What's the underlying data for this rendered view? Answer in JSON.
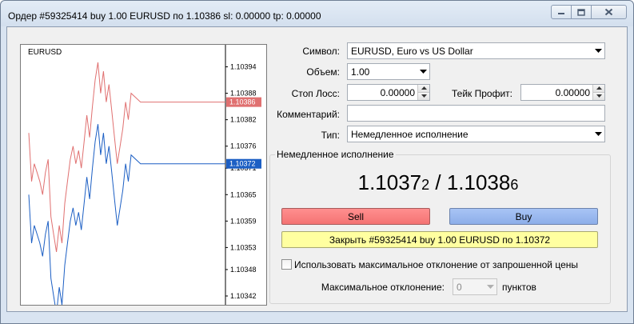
{
  "window": {
    "title": "Ордер #59325414 buy 1.00 EURUSD по 1.10386 sl: 0.00000 tp: 0.00000"
  },
  "chart": {
    "symbol": "EURUSD",
    "tick_labels": [
      "1.10394",
      "1.10388",
      "1.10382",
      "1.10376",
      "1.10371",
      "1.10365",
      "1.10359",
      "1.10353",
      "1.10348",
      "1.10342"
    ],
    "ask_tag": "1.10386",
    "bid_tag": "1.10372",
    "colors": {
      "ask": "#e07070",
      "bid": "#1c5fc4",
      "ask_tag_bg": "#e07070",
      "bid_tag_bg": "#1c5fc4"
    }
  },
  "chart_data": {
    "type": "line",
    "title": "EURUSD",
    "y_ticks": [
      1.10394,
      1.10388,
      1.10382,
      1.10376,
      1.10371,
      1.10365,
      1.10359,
      1.10353,
      1.10348,
      1.10342
    ],
    "ylim": [
      1.1034,
      1.10399
    ],
    "series": [
      {
        "name": "Ask",
        "values": [
          1.10379,
          1.10368,
          1.10372,
          1.1037,
          1.10368,
          1.10365,
          1.1037,
          1.10373,
          1.1036,
          1.10356,
          1.10352,
          1.10358,
          1.10354,
          1.10363,
          1.10368,
          1.10373,
          1.10376,
          1.10372,
          1.10375,
          1.10371,
          1.10377,
          1.10383,
          1.10378,
          1.10385,
          1.10391,
          1.10395,
          1.10388,
          1.10393,
          1.10386,
          1.1039,
          1.10384,
          1.10378,
          1.10372,
          1.10376,
          1.1038,
          1.10386,
          1.10382,
          1.10388,
          1.10386,
          1.10386,
          1.10386,
          1.10386,
          1.10386,
          1.10386,
          1.10386,
          1.10386,
          1.10386,
          1.10386
        ]
      },
      {
        "name": "Bid",
        "values": [
          1.10365,
          1.10354,
          1.10358,
          1.10356,
          1.10354,
          1.10351,
          1.10356,
          1.10359,
          1.10346,
          1.10342,
          1.10338,
          1.10344,
          1.1034,
          1.10349,
          1.10354,
          1.10359,
          1.10362,
          1.10358,
          1.10361,
          1.10357,
          1.10363,
          1.10369,
          1.10364,
          1.10371,
          1.10377,
          1.10381,
          1.10374,
          1.10379,
          1.10372,
          1.10376,
          1.1037,
          1.10364,
          1.10358,
          1.10362,
          1.10366,
          1.10372,
          1.10368,
          1.10374,
          1.10372,
          1.10372,
          1.10372,
          1.10372,
          1.10372,
          1.10372,
          1.10372,
          1.10372,
          1.10372,
          1.10372
        ]
      }
    ]
  },
  "form": {
    "symbol_label": "Символ:",
    "symbol_value": "EURUSD, Euro vs US Dollar",
    "volume_label": "Объем:",
    "volume_value": "1.00",
    "sl_label": "Стоп Лосс:",
    "sl_value": "0.00000",
    "tp_label": "Тейк Профит:",
    "tp_value": "0.00000",
    "comment_label": "Комментарий:",
    "comment_value": "",
    "type_label": "Тип:",
    "type_value": "Немедленное исполнение"
  },
  "execution": {
    "group_title": "Немедленное исполнение",
    "bid_main": "1.1037",
    "bid_small": "2",
    "separator": " / ",
    "ask_main": "1.1038",
    "ask_small": "6",
    "sell_label": "Sell",
    "buy_label": "Buy",
    "close_label": "Закрыть #59325414 buy 1.00 EURUSD по 1.10372",
    "deviation_checkbox_label": "Использовать максимальное отклонение от запрошенной цены",
    "max_dev_label": "Максимальное отклонение:",
    "max_dev_value": "0",
    "max_dev_unit": "пунктов"
  }
}
